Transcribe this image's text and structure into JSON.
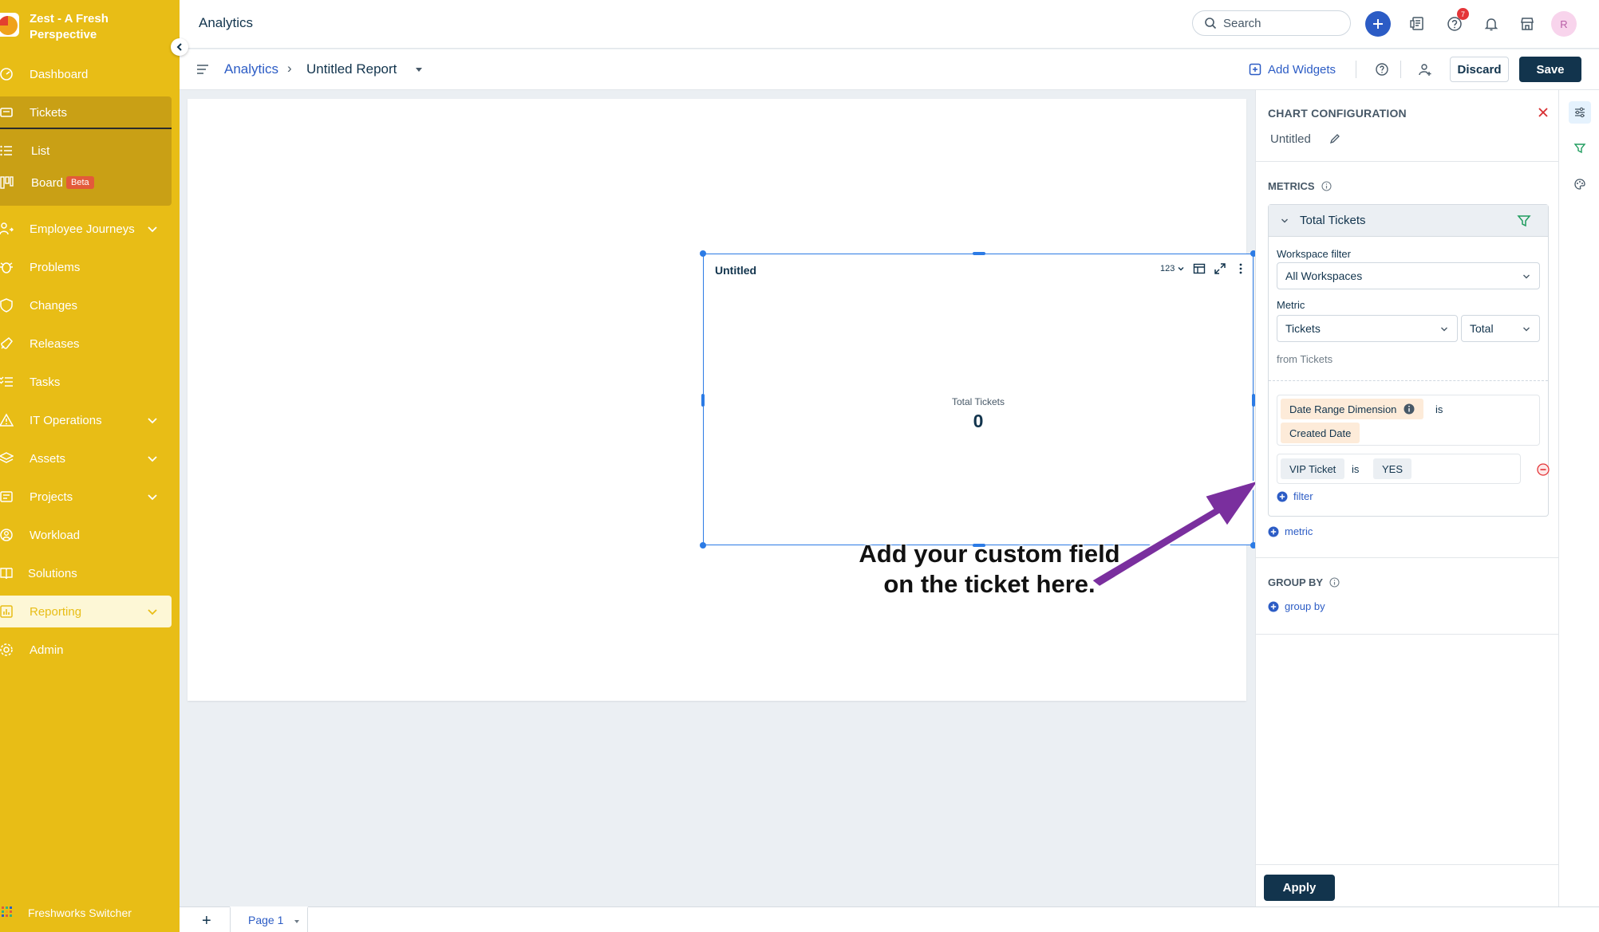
{
  "app": {
    "brand_name": "Zest - A Fresh Perspective",
    "page_heading": "Analytics"
  },
  "sidebar": {
    "items": [
      {
        "label": "Dashboard",
        "icon": "dashboard-icon"
      },
      {
        "label": "Tickets",
        "icon": "ticket-icon"
      },
      {
        "label": "List",
        "icon": "list-icon"
      },
      {
        "label": "Board",
        "icon": "board-icon",
        "badge": "Beta"
      },
      {
        "label": "Employee Journeys",
        "icon": "journey-icon"
      },
      {
        "label": "Problems",
        "icon": "bug-icon"
      },
      {
        "label": "Changes",
        "icon": "shield-icon"
      },
      {
        "label": "Releases",
        "icon": "release-icon"
      },
      {
        "label": "Tasks",
        "icon": "tasks-icon"
      },
      {
        "label": "IT Operations",
        "icon": "warning-icon"
      },
      {
        "label": "Assets",
        "icon": "layers-icon"
      },
      {
        "label": "Projects",
        "icon": "projects-icon"
      },
      {
        "label": "Workload",
        "icon": "workload-icon"
      },
      {
        "label": "Solutions",
        "icon": "book-icon"
      },
      {
        "label": "Reporting",
        "icon": "reporting-icon"
      },
      {
        "label": "Admin",
        "icon": "gear-icon"
      }
    ],
    "switcher_label": "Freshworks Switcher"
  },
  "topbar": {
    "search_placeholder": "Search",
    "notification_count": "7",
    "avatar_initial": "R"
  },
  "subbar": {
    "breadcrumb_root": "Analytics",
    "breadcrumb_separator": "›",
    "report_name": "Untitled Report",
    "add_widgets_label": "Add Widgets",
    "discard_label": "Discard",
    "save_label": "Save"
  },
  "widget": {
    "title": "Untitled",
    "format_label": "123",
    "kpi_label": "Total Tickets",
    "kpi_value": "0"
  },
  "annotation": {
    "text": "Add your custom field on the ticket here."
  },
  "config": {
    "title": "CHART CONFIGURATION",
    "chart_name": "Untitled",
    "metrics_label": "METRICS",
    "metric_name": "Total Tickets",
    "workspace_filter_label": "Workspace filter",
    "workspace_filter_value": "All Workspaces",
    "metric_label": "Metric",
    "metric_value": "Tickets",
    "aggregation_value": "Total",
    "from_text": "from Tickets",
    "date_range_chip": "Date Range Dimension",
    "date_range_operator": "is",
    "date_range_value": "Created Date",
    "vip_chip": "VIP Ticket",
    "vip_operator": "is",
    "vip_value": "YES",
    "add_filter_label": "filter",
    "add_metric_label": "metric",
    "group_by_label": "GROUP BY",
    "add_group_by_label": "group by",
    "apply_label": "Apply"
  },
  "pages": {
    "add_label": "+",
    "tabs": [
      {
        "label": "Page 1"
      }
    ]
  },
  "colors": {
    "sidebar_bg": "#e8bd16",
    "primary_dark": "#12344d",
    "link_blue": "#2c5cc5",
    "selection_blue": "#2c7be5",
    "annotation_arrow": "#7a2f9e"
  }
}
